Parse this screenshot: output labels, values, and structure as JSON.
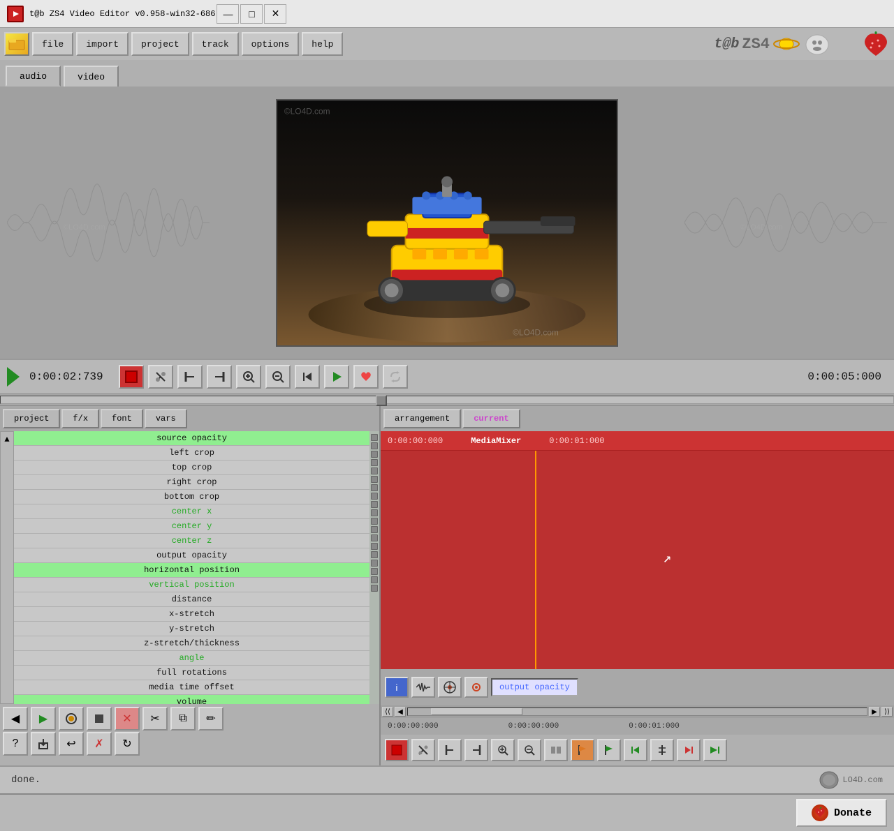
{
  "titlebar": {
    "icon": "🎬",
    "title": "t@b ZS4 Video Editor v0.958-win32-686",
    "minimize": "—",
    "maximize": "□",
    "close": "✕"
  },
  "menubar": {
    "file": "file",
    "import": "import",
    "project": "project",
    "track": "track",
    "options": "options",
    "help": "help"
  },
  "tabs": {
    "audio": "audio",
    "video": "video"
  },
  "transport": {
    "current_time": "0:00:02:739",
    "end_time": "0:00:05:000"
  },
  "left_panel": {
    "tab_project": "project",
    "tab_fx": "f/x",
    "tab_font": "font",
    "tab_vars": "vars",
    "params": [
      {
        "label": "source opacity",
        "style": "green"
      },
      {
        "label": "left crop",
        "style": "normal"
      },
      {
        "label": "top crop",
        "style": "normal"
      },
      {
        "label": "right crop",
        "style": "normal"
      },
      {
        "label": "bottom crop",
        "style": "normal"
      },
      {
        "label": "center x",
        "style": "green-text"
      },
      {
        "label": "center y",
        "style": "green-text"
      },
      {
        "label": "center z",
        "style": "green-text"
      },
      {
        "label": "output opacity",
        "style": "normal"
      },
      {
        "label": "horizontal position",
        "style": "green"
      },
      {
        "label": "vertical position",
        "style": "green-text"
      },
      {
        "label": "distance",
        "style": "normal"
      },
      {
        "label": "x-stretch",
        "style": "normal"
      },
      {
        "label": "y-stretch",
        "style": "normal"
      },
      {
        "label": "z-stretch/thickness",
        "style": "normal"
      },
      {
        "label": "angle",
        "style": "green-text"
      },
      {
        "label": "full rotations",
        "style": "normal"
      },
      {
        "label": "media time offset",
        "style": "normal"
      },
      {
        "label": "volume",
        "style": "green"
      }
    ]
  },
  "right_panel": {
    "tab_arrangement": "arrangement",
    "tab_current": "current",
    "timeline_start": "0:00:00:000",
    "timeline_mid": "MediaMixer",
    "timeline_end": "0:00:01:000",
    "bottom_label": "output opacity",
    "times_row": [
      "0:00:00:000",
      "0:00:00:000",
      "0:00:01:000"
    ]
  },
  "statusbar": {
    "text": "done.",
    "watermark": "LO4D.com"
  },
  "bottom": {
    "donate": "Donate",
    "donate_icon": "🍓"
  }
}
